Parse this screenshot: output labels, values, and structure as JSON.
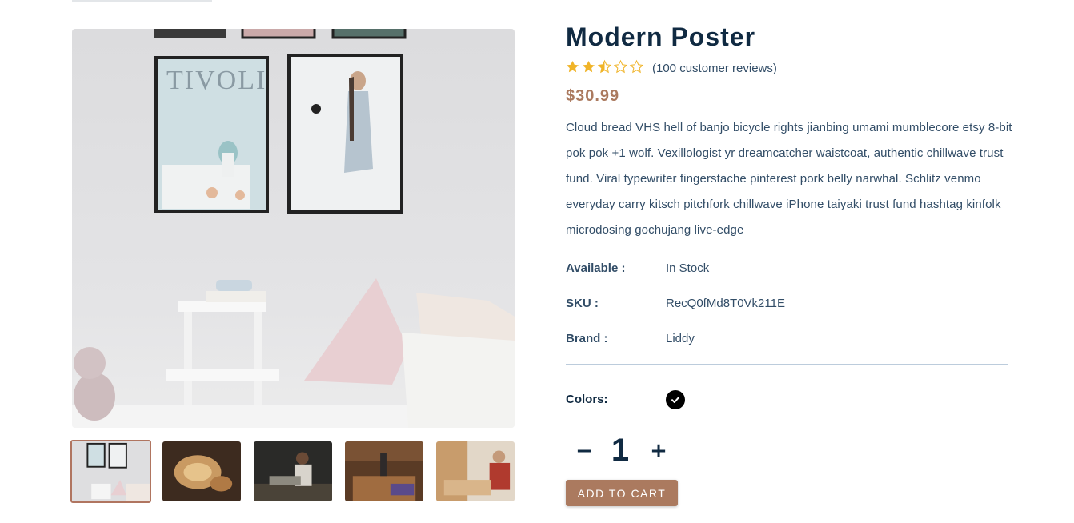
{
  "product": {
    "title": "Modern Poster",
    "rating": 2.5,
    "rating_max": 5,
    "reviews": "(100 customer reviews)",
    "price": "$30.99",
    "description": "Cloud bread VHS hell of banjo bicycle rights jianbing umami mumblecore etsy 8-bit pok pok +1 wolf. Vexillologist yr dreamcatcher waistcoat, authentic chillwave trust fund. Viral typewriter fingerstache pinterest pork belly narwhal. Schlitz venmo everyday carry kitsch pitchfork chillwave iPhone taiyaki trust fund hashtag kinfolk microdosing gochujang live-edge"
  },
  "info": {
    "available_label": "Available :",
    "available_value": "In Stock",
    "sku_label": "SKU :",
    "sku_value": "RecQ0fMd8T0Vk211E",
    "brand_label": "Brand :",
    "brand_value": "Liddy"
  },
  "colors": {
    "label": "Colors:",
    "options": [
      "#000000"
    ],
    "selected": "#000000"
  },
  "quantity": {
    "minus": "−",
    "value": "1",
    "plus": "+"
  },
  "cart": {
    "label": "ADD TO CART"
  },
  "gallery": {
    "selected_index": 0,
    "thumbs": [
      "poster-room-thumb",
      "wood-shavings-thumb",
      "craftsman-workshop-thumb",
      "woodshop-thumb",
      "carpenter-thumb"
    ]
  },
  "theme": {
    "accent": "#ab7a5f",
    "title": "#102a42",
    "text": "#324d67",
    "star": "#f0b429",
    "divider": "#bcccdc"
  },
  "icons": {
    "star_full": "star-filled-icon",
    "star_half": "star-half-icon",
    "star_empty": "star-outline-icon",
    "check": "check-icon"
  }
}
